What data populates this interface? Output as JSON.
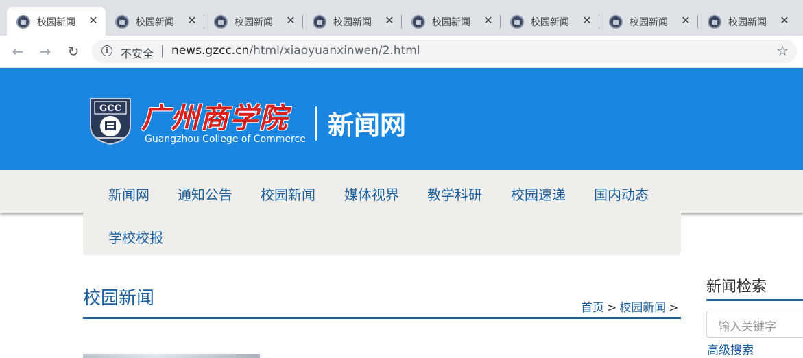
{
  "browser": {
    "tabs": [
      {
        "title": "校园新闻"
      },
      {
        "title": "校园新闻"
      },
      {
        "title": "校园新闻"
      },
      {
        "title": "校园新闻"
      },
      {
        "title": "校园新闻"
      },
      {
        "title": "校园新闻"
      },
      {
        "title": "校园新闻"
      },
      {
        "title": "校园新闻"
      }
    ],
    "close_glyph": "✕",
    "insecure_label": "不安全",
    "url_host": "news.gzcc.cn",
    "url_path": "/html/xiaoyuanxinwen/2.html"
  },
  "site": {
    "logo_cn": "广州商学院",
    "logo_en": "Guangzhou College of Commerce",
    "logo_sub": "新闻网",
    "logo_badge": "GCC",
    "brand_color": "#1b86e0"
  },
  "nav": {
    "items": [
      "新闻网",
      "通知公告",
      "校园新闻",
      "媒体视界",
      "教学科研",
      "校园速递",
      "国内动态",
      "学校校报"
    ]
  },
  "main": {
    "section_title": "校园新闻",
    "breadcrumb": {
      "home": "首页",
      "sep": ">",
      "current": "校园新闻",
      "trail": ">"
    }
  },
  "sidebar": {
    "title": "新闻检索",
    "search_placeholder": "输入关键字",
    "advanced": "高级搜索"
  }
}
